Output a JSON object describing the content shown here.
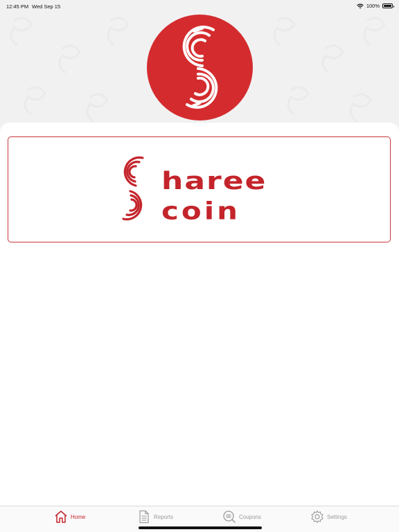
{
  "status_bar": {
    "time": "12:45 PM",
    "date": "Wed Sep 15",
    "battery": "100%"
  },
  "app": {
    "logo_icon": "sharee-s-logo-icon",
    "brand_line1": "haree",
    "brand_line2": "coin",
    "brand_color": "#c4242b"
  },
  "tabs": [
    {
      "label": "Home",
      "icon": "house-icon",
      "active": true
    },
    {
      "label": "Reports",
      "icon": "document-icon",
      "active": false
    },
    {
      "label": "Coupons",
      "icon": "coupon-icon",
      "active": false
    },
    {
      "label": "Settings",
      "icon": "gear-icon",
      "active": false
    }
  ]
}
